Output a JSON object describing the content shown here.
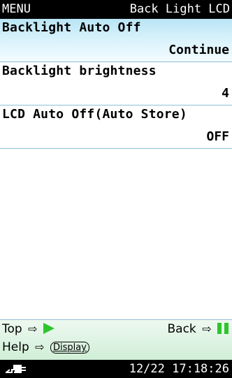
{
  "title_bar": {
    "left": "MENU",
    "right": "Back Light LCD"
  },
  "items": [
    {
      "label": "Backlight Auto Off",
      "value": "Continue"
    },
    {
      "label": "Backlight brightness",
      "value": "4"
    },
    {
      "label": "LCD Auto Off(Auto Store)",
      "value": "OFF"
    }
  ],
  "footer": {
    "top_label": "Top",
    "back_label": "Back",
    "help_label": "Help",
    "display_key": "Display",
    "arrow": "⇨"
  },
  "status_bar": {
    "datetime": "12/22 17:18:26",
    "power_icon": "ac-plug-icon"
  },
  "colors": {
    "selected_row": "#c9ecf9",
    "footer_bg": "#d8f2de",
    "key_green": "#2ec42e",
    "divider": "#8fbfd6"
  }
}
